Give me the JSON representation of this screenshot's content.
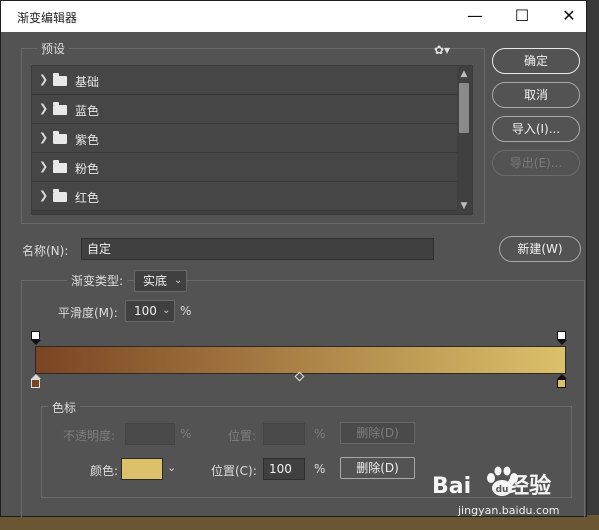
{
  "window": {
    "title": "渐变编辑器"
  },
  "presets": {
    "legend": "预设",
    "items": [
      {
        "label": "基础"
      },
      {
        "label": "蓝色"
      },
      {
        "label": "紫色"
      },
      {
        "label": "粉色"
      },
      {
        "label": "红色"
      }
    ]
  },
  "buttons": {
    "ok": "确定",
    "cancel": "取消",
    "import": "导入(I)...",
    "export": "导出(E)...",
    "new": "新建(W)"
  },
  "name_field": {
    "label": "名称(N):",
    "value": "自定"
  },
  "gradient": {
    "type_label": "渐变类型:",
    "type_value": "实底",
    "smoothness_label": "平滑度(M):",
    "smoothness_value": "100",
    "smoothness_unit": "%",
    "start_color": "#7b4423",
    "end_color": "#dcc06a"
  },
  "color_stops": {
    "legend": "色标",
    "opacity_label": "不透明度:",
    "opacity_unit": "%",
    "opacity_location_label": "位置:",
    "opacity_location_unit": "%",
    "opacity_delete": "删除(D)",
    "color_label": "颜色:",
    "color_value": "#dcc06a",
    "location_label": "位置(C):",
    "location_value": "100",
    "location_unit": "%",
    "delete": "删除(D)"
  },
  "watermark": {
    "brand": "Bai",
    "brand2": "经验",
    "url": "jingyan.baidu.com"
  }
}
